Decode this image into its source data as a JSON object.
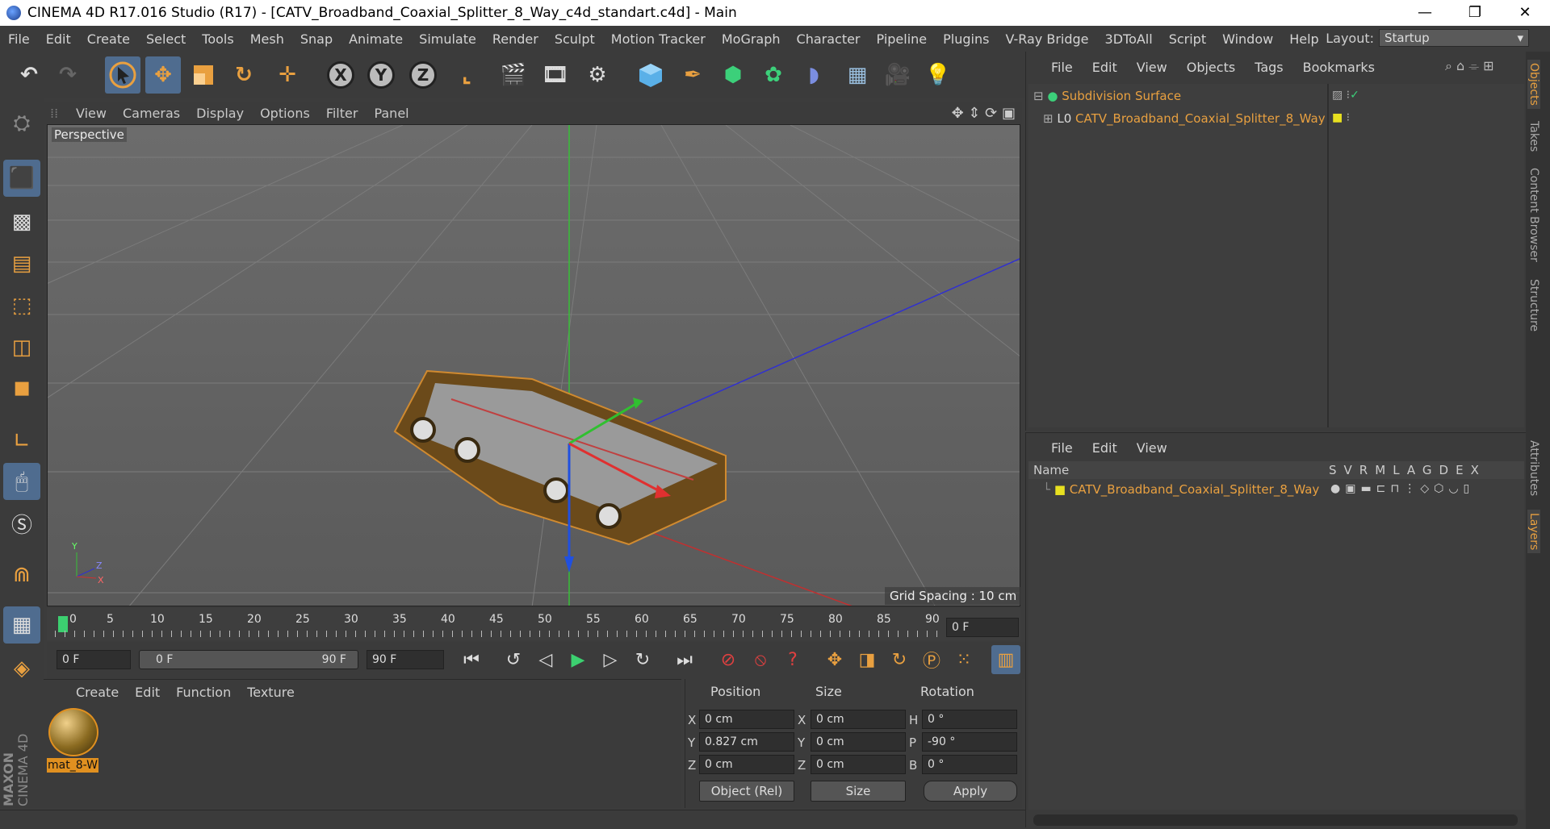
{
  "window": {
    "title": "CINEMA 4D R17.016 Studio (R17) - [CATV_Broadband_Coaxial_Splitter_8_Way_c4d_standart.c4d] - Main",
    "minimize": "—",
    "maximize": "❐",
    "close": "✕"
  },
  "menubar": {
    "items": [
      "File",
      "Edit",
      "Create",
      "Select",
      "Tools",
      "Mesh",
      "Snap",
      "Animate",
      "Simulate",
      "Render",
      "Sculpt",
      "Motion Tracker",
      "MoGraph",
      "Character",
      "Pipeline",
      "Plugins",
      "V-Ray Bridge",
      "3DToAll",
      "Script",
      "Window",
      "Help"
    ],
    "layout_label": "Layout:",
    "layout_value": "Startup"
  },
  "toolbar": {
    "axis_x": "X",
    "axis_y": "Y",
    "axis_z": "Z"
  },
  "viewport": {
    "menu": [
      "View",
      "Cameras",
      "Display",
      "Options",
      "Filter",
      "Panel"
    ],
    "label": "Perspective",
    "grid_spacing": "Grid Spacing : 10 cm",
    "axis_y": "Y",
    "axis_z": "Z",
    "axis_x": "X"
  },
  "timeline": {
    "ticks": [
      "0",
      "5",
      "10",
      "15",
      "20",
      "25",
      "30",
      "35",
      "40",
      "45",
      "50",
      "55",
      "60",
      "65",
      "70",
      "75",
      "80",
      "85",
      "90"
    ],
    "current_frame": "0 F",
    "start_field": "0 F",
    "range_start": "0 F",
    "range_end": "90 F",
    "end_field": "90 F"
  },
  "materials": {
    "menu": [
      "Create",
      "Edit",
      "Function",
      "Texture"
    ],
    "items": [
      {
        "label": "mat_8-W"
      }
    ]
  },
  "coords": {
    "headers": {
      "position": "Position",
      "size": "Size",
      "rotation": "Rotation"
    },
    "rows": [
      {
        "pl": "X",
        "pv": "0 cm",
        "sl": "X",
        "sv": "0 cm",
        "rl": "H",
        "rv": "0 °"
      },
      {
        "pl": "Y",
        "pv": "0.827 cm",
        "sl": "Y",
        "sv": "0 cm",
        "rl": "P",
        "rv": "-90 °"
      },
      {
        "pl": "Z",
        "pv": "0 cm",
        "sl": "Z",
        "sv": "0 cm",
        "rl": "B",
        "rv": "0 °"
      }
    ],
    "mode": "Object (Rel)",
    "size_mode": "Size",
    "apply": "Apply"
  },
  "objects": {
    "menu": [
      "File",
      "Edit",
      "View",
      "Objects",
      "Tags",
      "Bookmarks"
    ],
    "items": [
      {
        "name": "Subdivision Surface"
      },
      {
        "name": "CATV_Broadband_Coaxial_Splitter_8_Way"
      }
    ]
  },
  "layers": {
    "menu": [
      "File",
      "Edit",
      "View"
    ],
    "header_name": "Name",
    "columns": [
      "S",
      "V",
      "R",
      "M",
      "L",
      "A",
      "G",
      "D",
      "E",
      "X"
    ],
    "items": [
      {
        "name": "CATV_Broadband_Coaxial_Splitter_8_Way"
      }
    ]
  },
  "right_tabs": [
    "Objects",
    "Takes",
    "Content Browser",
    "Structure",
    "Attributes",
    "Layers"
  ],
  "brand": {
    "maxon": "MAXON",
    "cinema": "CINEMA 4D"
  },
  "colors": {
    "accent": "#e8a040",
    "selected": "#4f6c8f"
  }
}
